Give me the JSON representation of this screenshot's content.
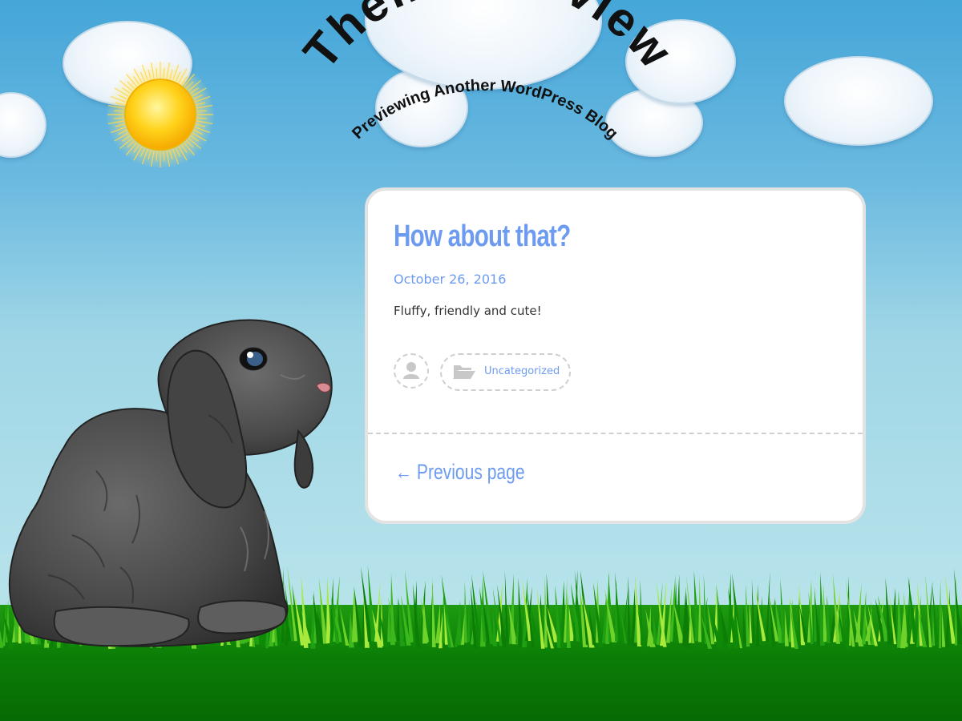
{
  "site": {
    "title": "Theme Preview",
    "tagline": "Previewing Another WordPress Blog"
  },
  "post": {
    "title": "How about that?",
    "date": "October 26, 2016",
    "excerpt": "Fluffy, friendly and cute!",
    "category": "Uncategorized"
  },
  "navigation": {
    "previous_label": "← Previous page"
  },
  "icons": {
    "author": "user-icon",
    "category": "folder-open-icon"
  },
  "colors": {
    "accent": "#6d9bf1",
    "text": "#333333",
    "card_border": "#e3e3e3",
    "grass_dark": "#0a7a06",
    "grass_light": "#8ee03a",
    "sky_top": "#45a6d8"
  }
}
